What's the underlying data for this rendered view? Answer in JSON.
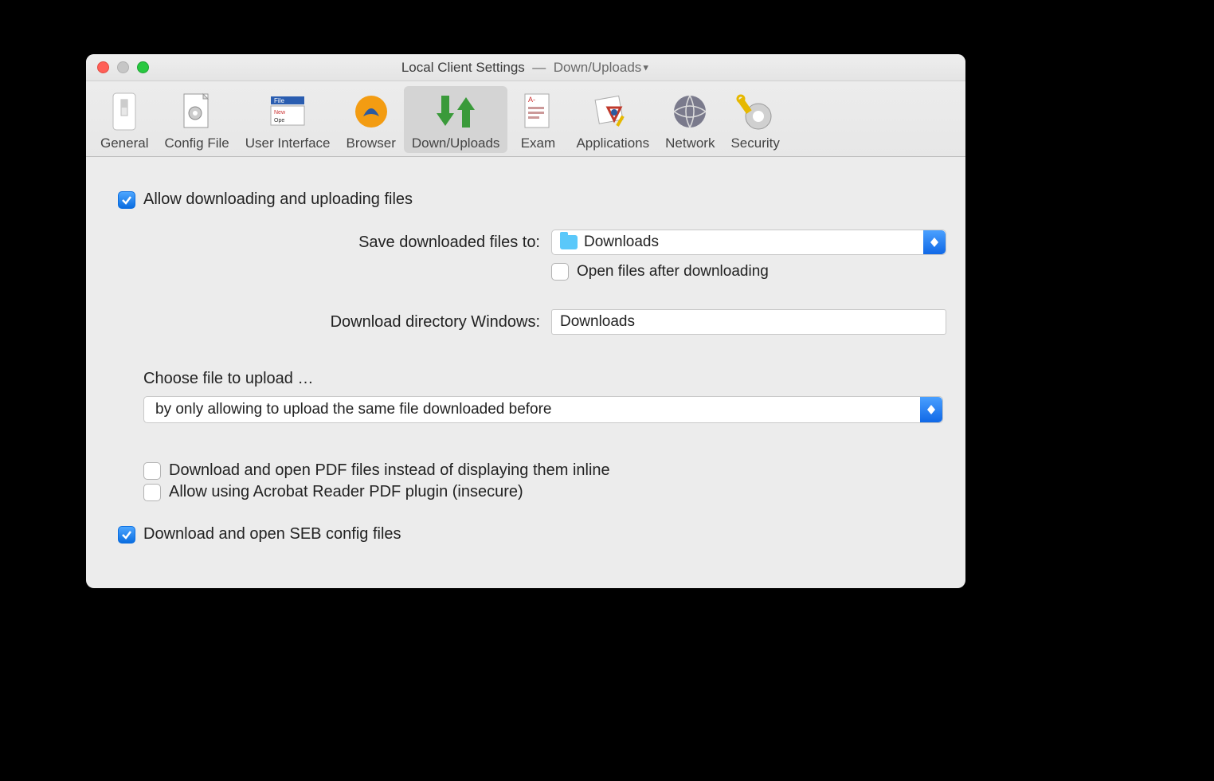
{
  "title": {
    "main": "Local Client Settings",
    "sep": "—",
    "sub": "Down/Uploads"
  },
  "toolbar": {
    "general": "General",
    "config": "Config File",
    "ui": "User Interface",
    "browser": "Browser",
    "down": "Down/Uploads",
    "exam": "Exam",
    "apps": "Applications",
    "network": "Network",
    "security": "Security"
  },
  "main": {
    "allow": "Allow downloading and uploading files",
    "save_label": "Save downloaded files to:",
    "save_value": "Downloads",
    "open_after": "Open files after downloading",
    "dir_win_label": "Download directory Windows:",
    "dir_win_value": "Downloads",
    "upload_label": "Choose file to upload …",
    "upload_value": "by only allowing to upload the same file downloaded before",
    "pdf_inline": "Download and open PDF files instead of displaying them inline",
    "acrobat": "Allow using Acrobat Reader PDF plugin (insecure)",
    "seb_cfg": "Download and open SEB config files"
  }
}
